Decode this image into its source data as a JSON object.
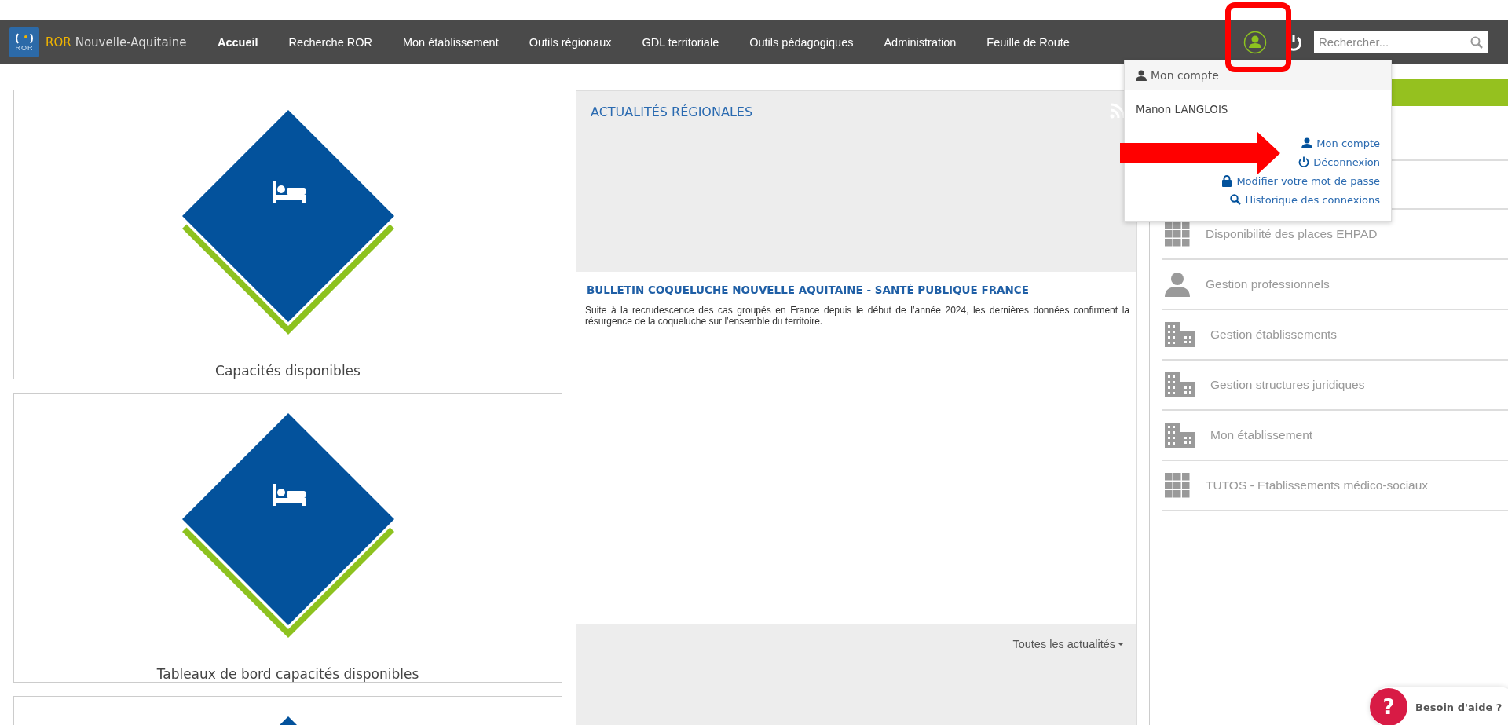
{
  "header": {
    "logo": {
      "badge": "ROR",
      "brand": "ROR",
      "region": "Nouvelle-Aquitaine"
    },
    "nav": [
      {
        "label": "Accueil",
        "selected": true
      },
      {
        "label": "Recherche ROR",
        "selected": false
      },
      {
        "label": "Mon établissement",
        "selected": false
      },
      {
        "label": "Outils régionaux",
        "selected": false
      },
      {
        "label": "GDL territoriale",
        "selected": false
      },
      {
        "label": "Outils pédagogiques",
        "selected": false
      },
      {
        "label": "Administration",
        "selected": false
      },
      {
        "label": "Feuille de Route",
        "selected": false
      }
    ],
    "search": {
      "placeholder": "Rechercher..."
    }
  },
  "tiles": [
    {
      "kind": "bed",
      "caption": "Capacités disponibles"
    },
    {
      "kind": "bed",
      "caption": "Tableaux de bord capacités disponibles"
    },
    {
      "kind": "plain"
    }
  ],
  "news": {
    "title": "ACTUALITÉS RÉGIONALES",
    "articles": [
      {
        "title": "BULLETIN COQUELUCHE NOUVELLE AQUITAINE - SANTÉ PUBLIQUE FRANCE",
        "summary": "Suite à la recrudescence des cas groupés en France depuis le début de l’année 2024, les dernières données confirment la résurgence de la coqueluche sur l’ensemble du territoire."
      }
    ],
    "more_link": "Toutes les actualités"
  },
  "shortcuts": [
    {
      "kind": "grid",
      "label": "Disponibilité des places EHPAD"
    },
    {
      "kind": "person",
      "label": "Gestion professionnels"
    },
    {
      "kind": "building",
      "label": "Gestion établissements"
    },
    {
      "kind": "building",
      "label": "Gestion structures juridiques"
    },
    {
      "kind": "building",
      "label": "Mon établissement"
    },
    {
      "kind": "grid",
      "label": "TUTOS - Etablissements médico-sociaux"
    }
  ],
  "account_menu": {
    "title": "Mon compte",
    "user": "Manon LANGLOIS",
    "links": [
      {
        "kind": "account",
        "label": "Mon compte"
      },
      {
        "kind": "logout",
        "label": "Déconnexion"
      },
      {
        "kind": "password",
        "label": "Modifier votre mot de passe"
      },
      {
        "kind": "history",
        "label": "Historique des connexions"
      }
    ]
  },
  "help": {
    "icon": "?",
    "label": "Besoin d'aide ?"
  }
}
